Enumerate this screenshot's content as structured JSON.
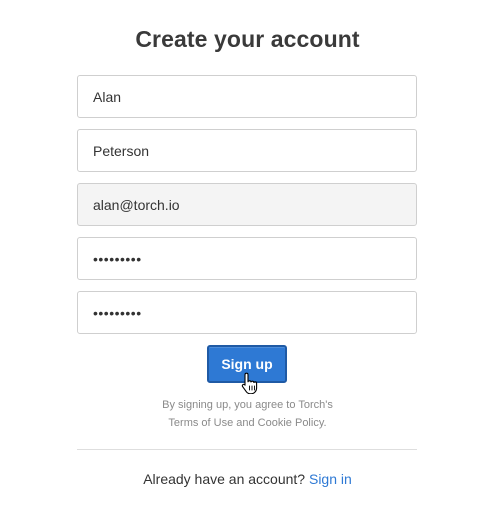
{
  "page": {
    "title": "Create your account"
  },
  "form": {
    "first_name": {
      "value": "Alan"
    },
    "last_name": {
      "value": "Peterson"
    },
    "email": {
      "value": "alan@torch.io"
    },
    "password": {
      "value": "•••••••••"
    },
    "confirm_password": {
      "value": "•••••••••"
    },
    "submit_label": "Sign up"
  },
  "legal": {
    "line1": "By signing up, you agree to Torch's",
    "line2": "Terms of Use and Cookie Policy."
  },
  "footer": {
    "prompt": "Already have an account?",
    "signin_label": "Sign in"
  },
  "colors": {
    "accent": "#2e79d4",
    "accent_border": "#1f5aa5",
    "disabled_bg": "#f4f4f4",
    "border": "#cfcfcf"
  },
  "icons": {
    "cursor": "pointer-hand-icon"
  }
}
